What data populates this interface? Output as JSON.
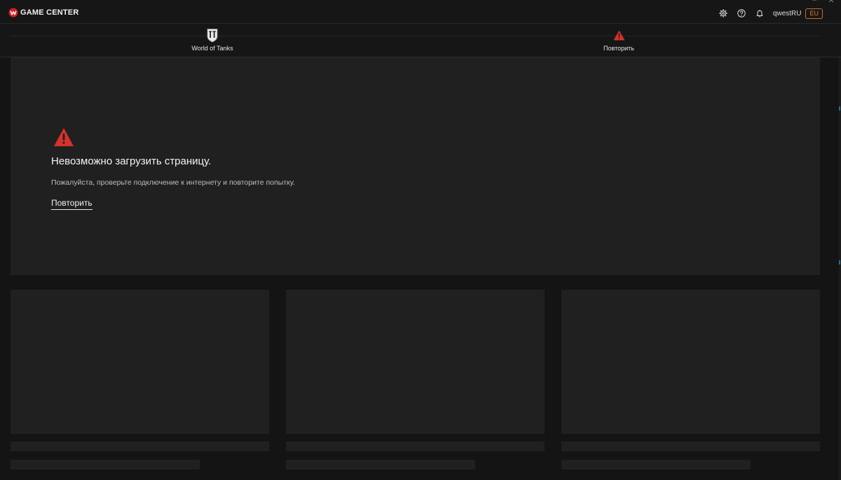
{
  "app": {
    "title": "GAME CENTER"
  },
  "window_controls": {
    "minimize": "–",
    "close": "✕"
  },
  "header": {
    "username": "qwestRU",
    "region": "EU",
    "icons": [
      "gear-icon",
      "help-icon",
      "bell-icon"
    ]
  },
  "games": [
    {
      "label": "World of Tanks",
      "icon": "world-of-tanks-icon"
    },
    {
      "label": "Повторить",
      "icon": "warning-icon"
    }
  ],
  "error": {
    "title": "Невозможно загрузить страницу.",
    "message": "Пожалуйста, проверьте подключение к интернету и повторите попытку.",
    "retry_label": "Повторить"
  },
  "colors": {
    "background": "#141414",
    "panel": "#202020",
    "accent_warning": "#d4322a",
    "region_border": "#c46f2a",
    "brand_red": "#d01f26"
  }
}
